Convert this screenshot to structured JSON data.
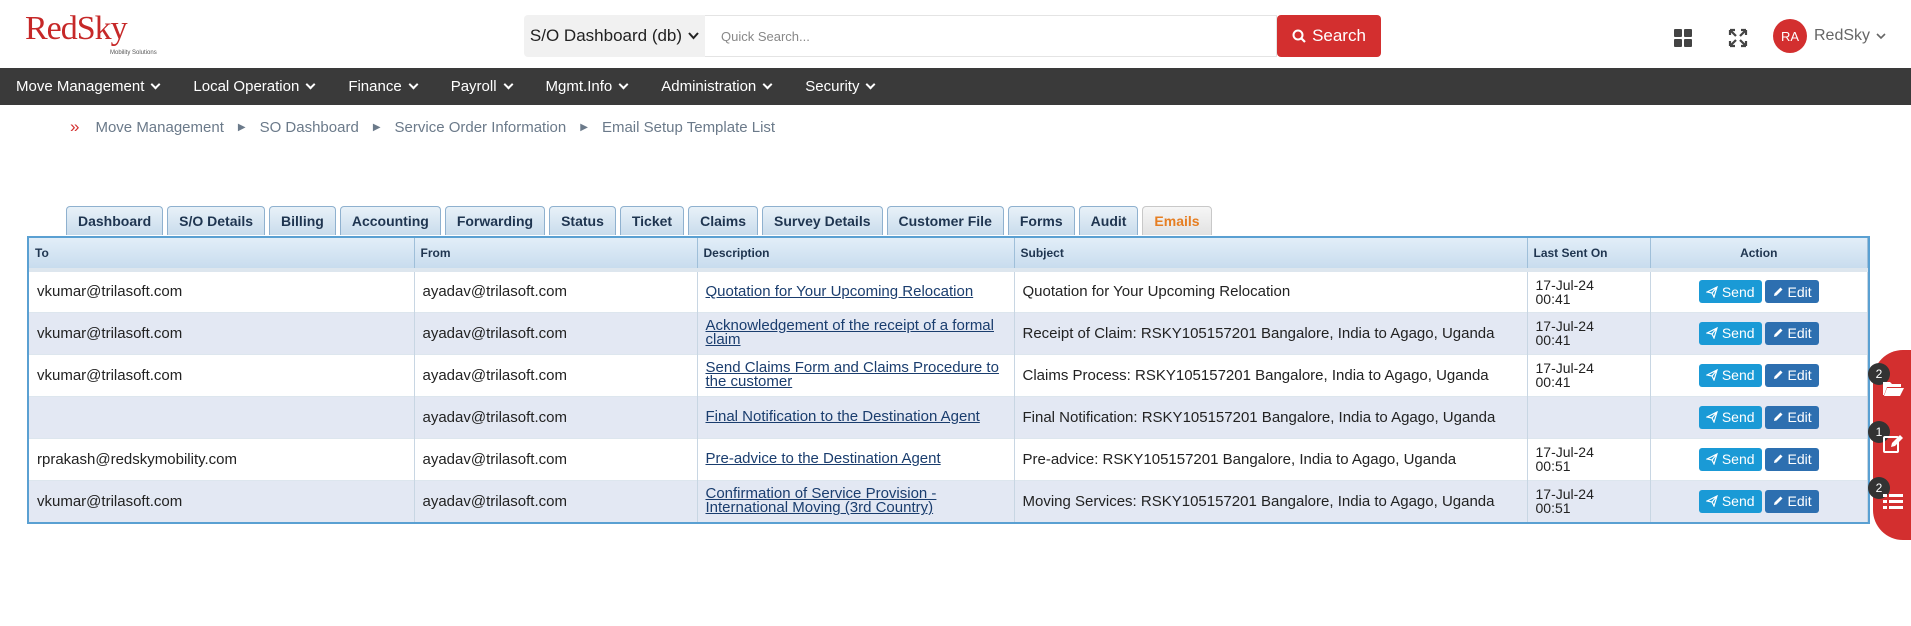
{
  "header": {
    "logo_text": "RedSky",
    "logo_subtitle": "Mobility Solutions",
    "dashboard_select": "S/O Dashboard (db)",
    "search_placeholder": "Quick Search...",
    "search_button": "Search",
    "avatar_initials": "RA",
    "user_name": "RedSky"
  },
  "nav": {
    "items": [
      "Move Management",
      "Local Operation",
      "Finance",
      "Payroll",
      "Mgmt.Info",
      "Administration",
      "Security"
    ]
  },
  "breadcrumb": {
    "items": [
      "Move Management",
      "SO Dashboard",
      "Service Order Information",
      "Email Setup Template List"
    ]
  },
  "tabs": [
    "Dashboard",
    "S/O Details",
    "Billing",
    "Accounting",
    "Forwarding",
    "Status",
    "Ticket",
    "Claims",
    "Survey Details",
    "Customer File",
    "Forms",
    "Audit",
    "Emails"
  ],
  "active_tab": "Emails",
  "table": {
    "columns": [
      "To",
      "From",
      "Description",
      "Subject",
      "Last Sent On",
      "Action"
    ],
    "rows": [
      {
        "to": "vkumar@trilasoft.com",
        "from": "ayadav@trilasoft.com",
        "description": "Quotation for Your Upcoming Relocation",
        "subject": "Quotation for Your Upcoming Relocation",
        "date": "17-Jul-24",
        "time": "00:41"
      },
      {
        "to": "vkumar@trilasoft.com",
        "from": "ayadav@trilasoft.com",
        "description": "Acknowledgement of the receipt of a formal claim",
        "subject": "Receipt of Claim: RSKY105157201 Bangalore, India to Agago, Uganda",
        "date": "17-Jul-24",
        "time": "00:41"
      },
      {
        "to": "vkumar@trilasoft.com",
        "from": "ayadav@trilasoft.com",
        "description": "Send Claims Form and Claims Procedure to the customer",
        "subject": "Claims Process: RSKY105157201 Bangalore, India to Agago, Uganda",
        "date": "17-Jul-24",
        "time": "00:41"
      },
      {
        "to": "",
        "from": "ayadav@trilasoft.com",
        "description": "Final Notification to the Destination Agent",
        "subject": "Final Notification: RSKY105157201 Bangalore, India to Agago, Uganda",
        "date": "",
        "time": ""
      },
      {
        "to": "rprakash@redskymobility.com",
        "from": "ayadav@trilasoft.com",
        "description": "Pre-advice to the Destination Agent",
        "subject": "Pre-advice: RSKY105157201 Bangalore, India to Agago, Uganda",
        "date": "17-Jul-24",
        "time": "00:51"
      },
      {
        "to": "vkumar@trilasoft.com",
        "from": "ayadav@trilasoft.com",
        "description": "Confirmation of Service Provision - International Moving (3rd Country)",
        "subject": "Moving Services: RSKY105157201 Bangalore, India to Agago, Uganda",
        "date": "17-Jul-24",
        "time": "00:51"
      }
    ],
    "send_label": "Send",
    "edit_label": "Edit"
  },
  "side_panel": {
    "badges": [
      "2",
      "1",
      "2"
    ],
    "icons": [
      "folder-open-icon",
      "edit-icon",
      "list-icon"
    ]
  },
  "colors": {
    "brand_red": "#d32f2f",
    "nav_bg": "#3a3a3a",
    "send_button": "#1a9ad6",
    "edit_button": "#2d6fb0",
    "active_tab_text": "#e67e22"
  }
}
